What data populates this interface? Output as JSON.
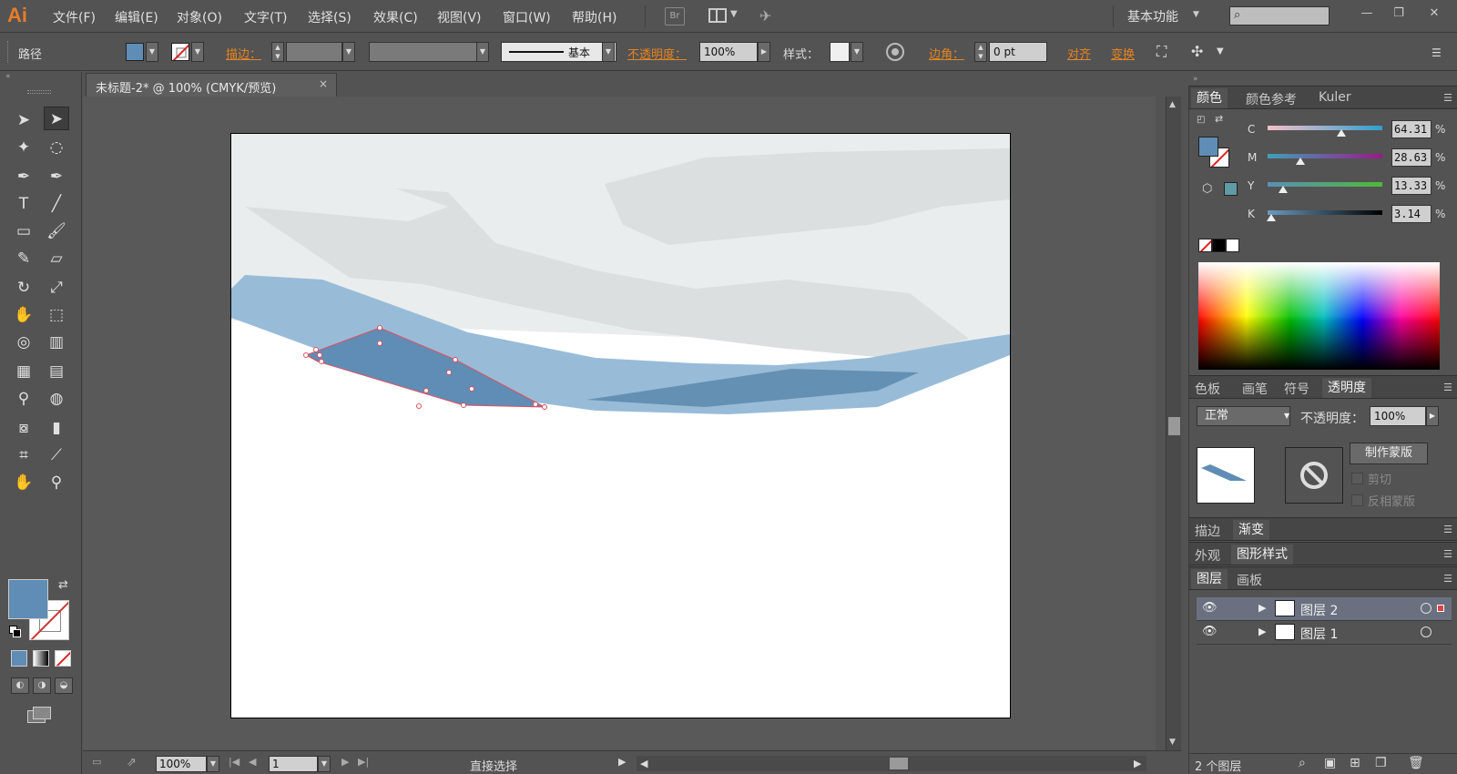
{
  "app": {
    "logo": "Ai",
    "menu": [
      "文件(F)",
      "编辑(E)",
      "对象(O)",
      "文字(T)",
      "选择(S)",
      "效果(C)",
      "视图(V)",
      "窗口(W)",
      "帮助(H)"
    ],
    "bridge_label": "Br",
    "workspace": "基本功能",
    "window_controls": [
      "—",
      "❐",
      "✕"
    ]
  },
  "controlbar": {
    "object_type": "路径",
    "fill_color": "#5f8db5",
    "stroke_label": "描边：",
    "stroke_style_label": "基本",
    "opacity_label": "不透明度：",
    "opacity_value": "100%",
    "style_label": "样式：",
    "corner_label": "边角：",
    "corner_value": "0 pt",
    "align_label": "对齐",
    "transform_label": "变换"
  },
  "document": {
    "tab_title": "未标题-2* @ 100% (CMYK/预览)",
    "close_glyph": "×"
  },
  "statusbar": {
    "zoom": "100%",
    "page": "1",
    "tool_name": "直接选择"
  },
  "color_panel": {
    "tabs": [
      "颜色",
      "颜色参考",
      "Kuler"
    ],
    "channels": [
      {
        "label": "C",
        "value": "64.31",
        "fraction": 0.643,
        "gradient": "linear-gradient(to right, #f5c0c8, #2f9fcf)"
      },
      {
        "label": "M",
        "value": "28.63",
        "fraction": 0.286,
        "gradient": "linear-gradient(to right, #3fa0b8, #9a1a8a)"
      },
      {
        "label": "Y",
        "value": "13.33",
        "fraction": 0.133,
        "gradient": "linear-gradient(to right, #5a8fb6, #4fb83a)"
      },
      {
        "label": "K",
        "value": "3.14",
        "fraction": 0.031,
        "gradient": "linear-gradient(to right, #6a9ac0, #000000)"
      }
    ],
    "percent_sign": "%",
    "fill_color": "#5f8db5",
    "gamut_swatch": "#5f9aa5"
  },
  "transparency_panel": {
    "tabs": [
      "色板",
      "画笔",
      "符号",
      "透明度"
    ],
    "blend_mode": "正常",
    "opacity_label": "不透明度：",
    "opacity_value": "100%",
    "make_mask": "制作蒙版",
    "clip": "剪切",
    "invert_mask": "反相蒙版"
  },
  "collapsed_panels": {
    "stroke_tabs": [
      "描边",
      "渐变"
    ],
    "appearance_tabs": [
      "外观",
      "图形样式"
    ]
  },
  "layers_panel": {
    "tabs": [
      "图层",
      "画板"
    ],
    "layers": [
      {
        "name": "图层 2",
        "selected": true
      },
      {
        "name": "图层 1",
        "selected": false
      }
    ],
    "count": "2 个图层"
  }
}
